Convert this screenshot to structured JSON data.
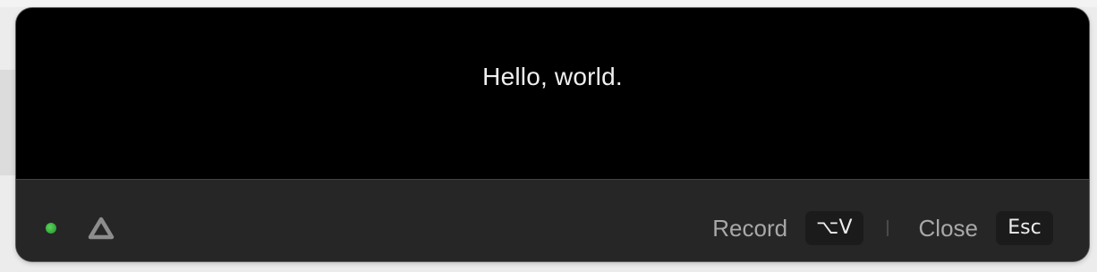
{
  "panel": {
    "content_text": "Hello, world."
  },
  "footer": {
    "status_color": "#3cc243",
    "logo_icon": "triangle-logo-icon",
    "record": {
      "label": "Record",
      "shortcut": "⌥V"
    },
    "close": {
      "label": "Close",
      "shortcut": "Esc"
    }
  }
}
